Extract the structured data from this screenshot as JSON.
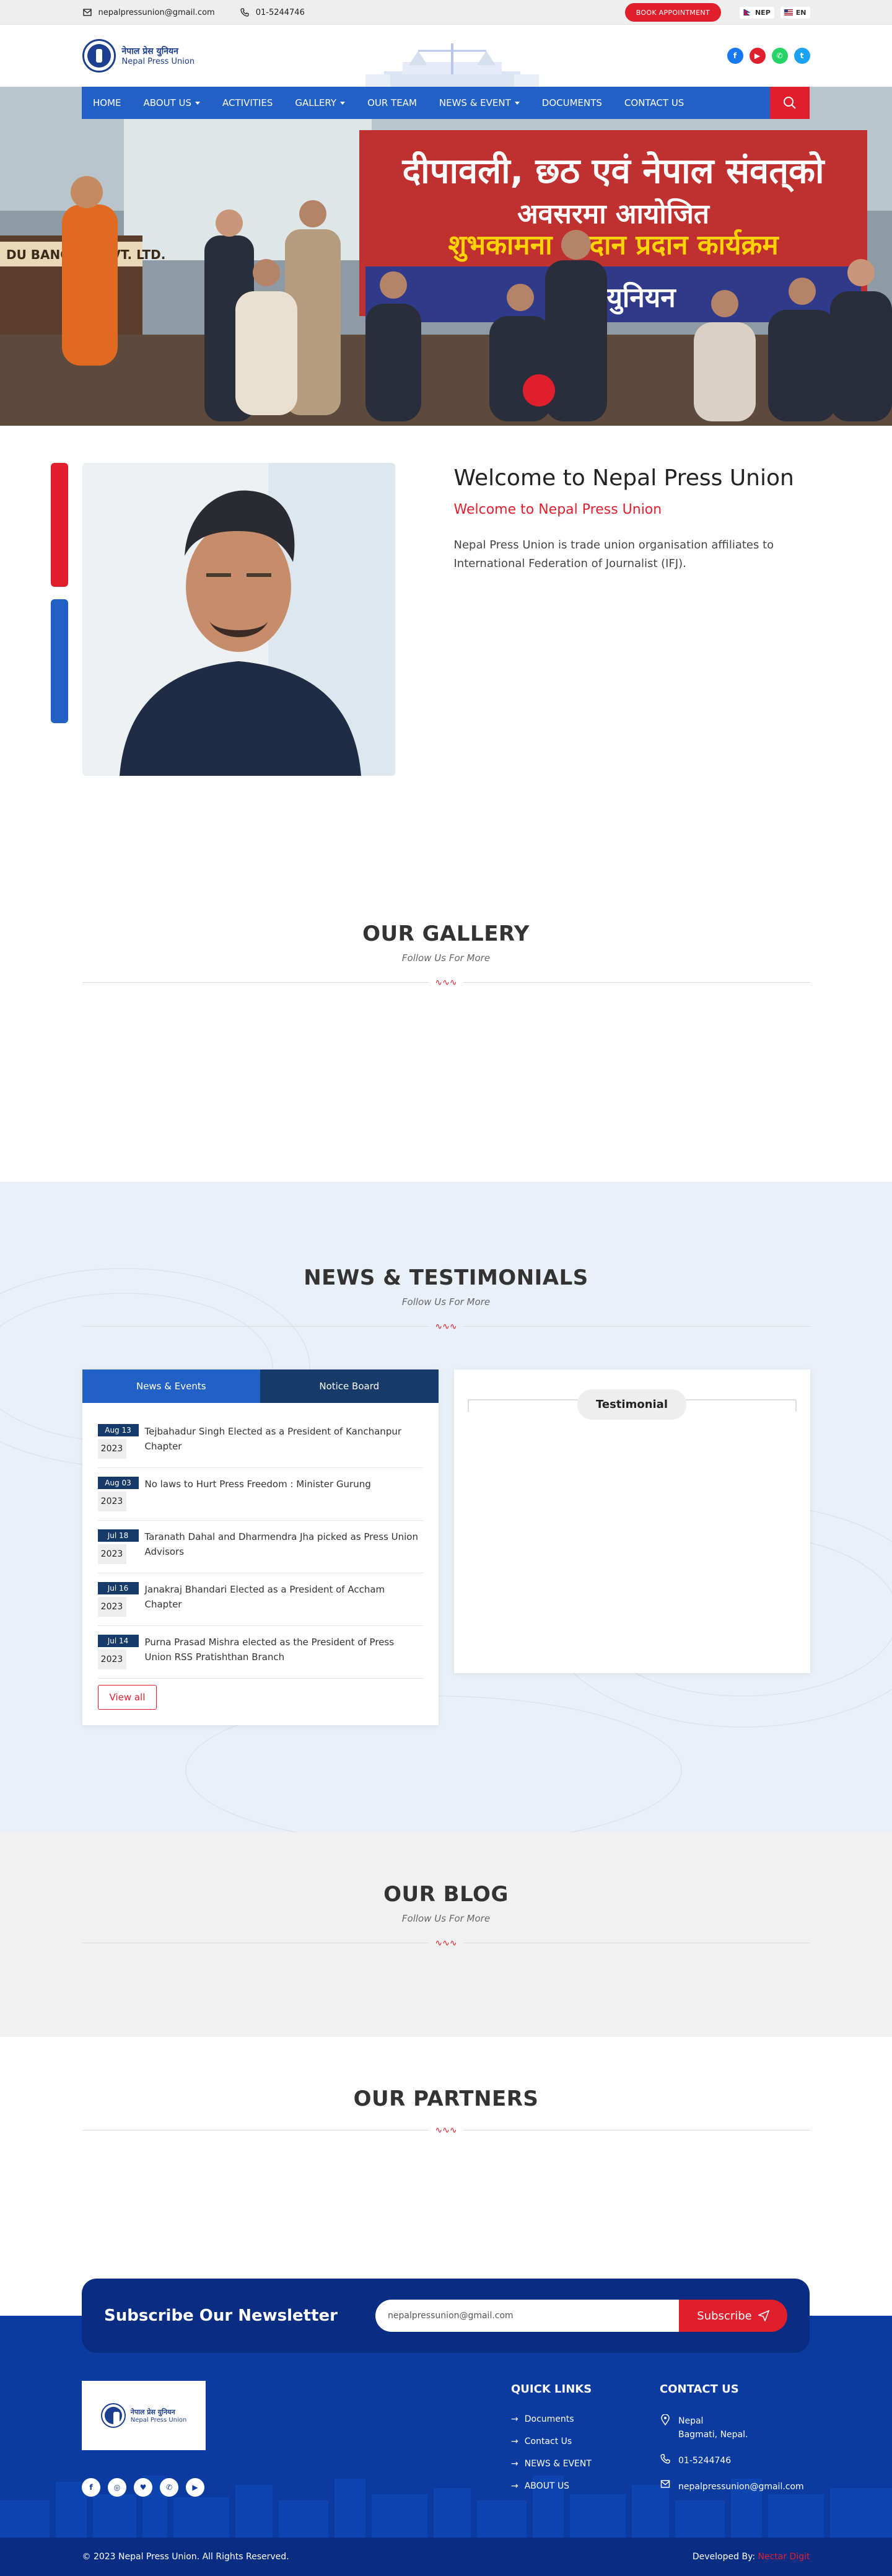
{
  "topbar": {
    "email": "nepalpressunion@gmail.com",
    "phone": "01-5244746",
    "book_label": "BOOK APPOINTMENT",
    "lang_nep": "NEP",
    "lang_en": "EN"
  },
  "brand": {
    "name_np": "नेपाल प्रेस युनियन",
    "name_en": "Nepal Press Union"
  },
  "nav": {
    "items": [
      {
        "label": "HOME"
      },
      {
        "label": "ABOUT US"
      },
      {
        "label": "ACTIVITIES"
      },
      {
        "label": "GALLERY"
      },
      {
        "label": "OUR TEAM"
      },
      {
        "label": "NEWS & EVENT"
      },
      {
        "label": "DOCUMENTS"
      },
      {
        "label": "CONTACT US"
      }
    ]
  },
  "hero": {
    "banner_line1": "दीपावली, छठ एवं नेपाल संवत्‌को",
    "banner_line2": "अवसरमा आयोजित",
    "banner_line3": "शुभकामना आदान प्रदान कार्यक्रम",
    "banner_org": "प्रेस युनियन",
    "podium": "DU BANQUET PVT. LTD."
  },
  "welcome": {
    "title": "Welcome to Nepal Press Union",
    "subtitle": "Welcome to Nepal Press Union",
    "body": "Nepal Press Union is trade union organisation affiliates to International Federation of Journalist (IFJ)."
  },
  "gallery": {
    "title": "OUR GALLERY",
    "sub": "Follow Us For More"
  },
  "news": {
    "title": "NEWS & TESTIMONIALS",
    "sub": "Follow Us For More",
    "tab_news": "News & Events",
    "tab_notice": "Notice Board",
    "items": [
      {
        "md": "Aug 13",
        "year": "2023",
        "title": "Tejbahadur Singh Elected as a President of Kanchanpur Chapter"
      },
      {
        "md": "Aug 03",
        "year": "2023",
        "title": "No laws to Hurt Press Freedom : Minister Gurung"
      },
      {
        "md": "Jul 18",
        "year": "2023",
        "title": "Taranath Dahal and Dharmendra Jha picked as Press Union Advisors"
      },
      {
        "md": "Jul 16",
        "year": "2023",
        "title": "Janakraj Bhandari Elected as a President of Accham Chapter"
      },
      {
        "md": "Jul 14",
        "year": "2023",
        "title": "Purna Prasad Mishra elected as the President of Press Union RSS Pratishthan Branch"
      }
    ],
    "view_all": "View all",
    "testimonial": "Testimonial"
  },
  "blog": {
    "title": "OUR BLOG",
    "sub": "Follow Us For More"
  },
  "partners": {
    "title": "OUR PARTNERS"
  },
  "footer": {
    "newsletter_title": "Subscribe Our Newsletter",
    "newsletter_value": "nepalpressunion@gmail.com",
    "subscribe_label": "Subscribe",
    "quick_title": "QUICK LINKS",
    "links": [
      {
        "label": "Documents"
      },
      {
        "label": "Contact Us"
      },
      {
        "label": "NEWS & EVENT"
      },
      {
        "label": "ABOUT US"
      }
    ],
    "contact_title": "CONTACT US",
    "address_line1": "Nepal",
    "address_line2": "Bagmati, Nepal.",
    "phone": "01-5244746",
    "email": "nepalpressunion@gmail.com",
    "copyright": "© 2023 Nepal Press Union. All Rights Reserved.",
    "developed_prefix": "Developed By:",
    "developed_name": "Nectar Digit"
  },
  "colors": {
    "brand_blue": "#2160c4",
    "accent_red": "#e01f2d",
    "navy": "#0a2d84"
  }
}
